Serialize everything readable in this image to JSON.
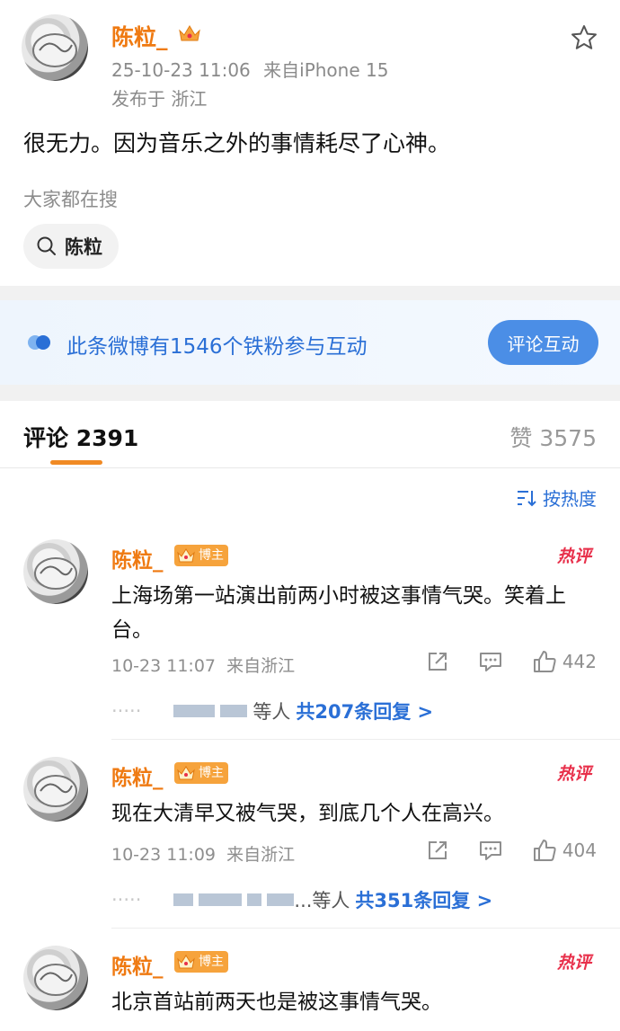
{
  "post": {
    "author": "陈粒_",
    "time": "25-10-23 11:06",
    "source": "来自iPhone 15",
    "location": "发布于 浙江",
    "text": "很无力。因为音乐之外的事情耗尽了心神。",
    "hot_label": "大家都在搜",
    "search_chip": "陈粒"
  },
  "banner": {
    "text": "此条微博有1546个铁粉参与互动",
    "button": "评论互动"
  },
  "comments_header": {
    "tab_label": "评论 2391",
    "likes_label": "赞 3575",
    "sort_label": "按热度"
  },
  "comments": [
    {
      "author": "陈粒_",
      "badge": "博主",
      "hot": "热评",
      "text": "上海场第一站演出前两小时被这事情气哭。笑着上台。",
      "time": "10-23 11:07",
      "source": "来自浙江",
      "likes": "442",
      "reply_suffix": "等人",
      "reply_link": "共207条回复 >"
    },
    {
      "author": "陈粒_",
      "badge": "博主",
      "hot": "热评",
      "text": "现在大清早又被气哭，到底几个人在高兴。",
      "time": "10-23 11:09",
      "source": "来自浙江",
      "likes": "404",
      "reply_suffix": "...等人",
      "reply_link": "共351条回复 >"
    },
    {
      "author": "陈粒_",
      "badge": "博主",
      "hot": "热评",
      "text": "北京首站前两天也是被这事情气哭。"
    }
  ],
  "colors": {
    "accent": "#ef7a12",
    "link": "#2a6fd6",
    "hot": "#e8304b"
  }
}
